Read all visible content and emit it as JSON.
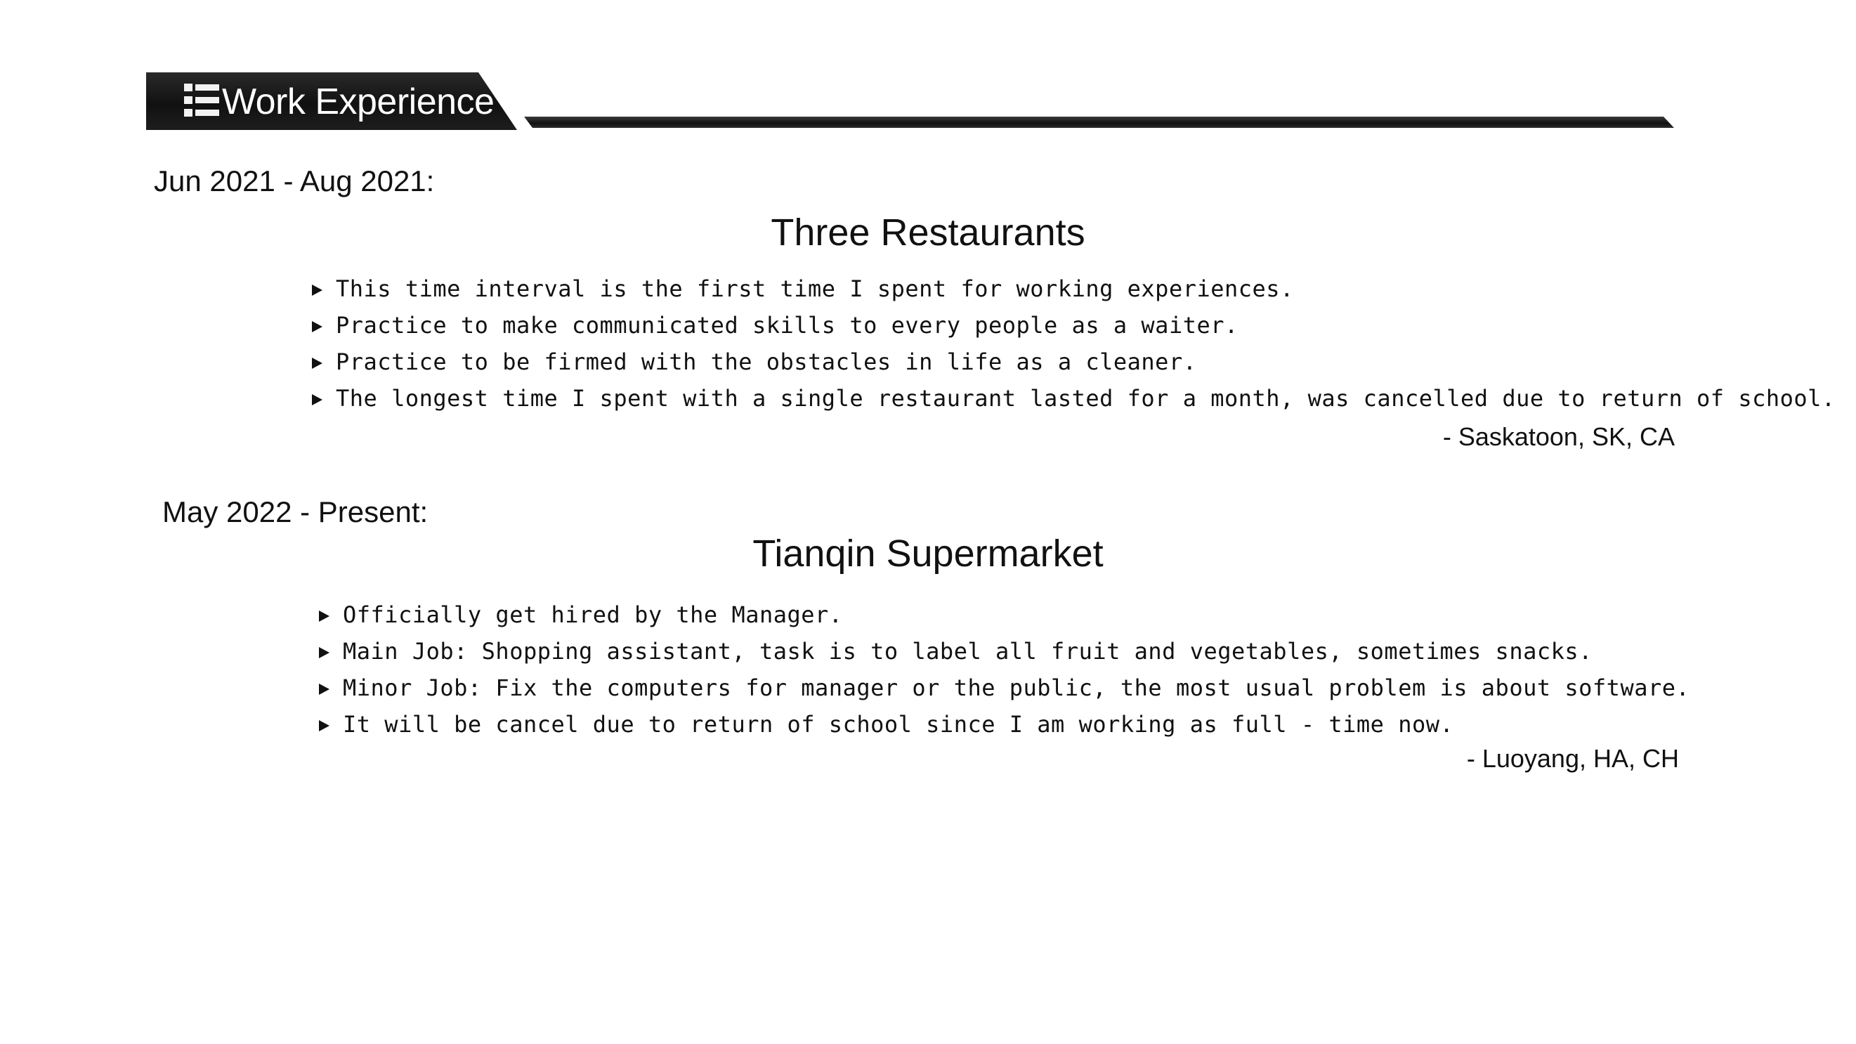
{
  "section": {
    "title": "Work Experience",
    "icon": "list-icon"
  },
  "entries": [
    {
      "date": "Jun 2021 - Aug 2021:",
      "company": "Three Restaurants",
      "bullets": [
        "This time interval is the first time I spent for working experiences.",
        "Practice to make communicated skills to every people as a waiter.",
        "Practice to be firmed with the obstacles in life as a cleaner.",
        "The longest time I spent with a single restaurant lasted for a month, was cancelled due to return of school."
      ],
      "location": "- Saskatoon, SK, CA"
    },
    {
      "date": "May 2022 - Present:",
      "company": "Tianqin Supermarket",
      "bullets": [
        "Officially get hired by the Manager.",
        "Main Job: Shopping assistant, task is to label all fruit and vegetables, sometimes snacks.",
        "Minor Job: Fix the computers for manager or the public, the most usual problem is about software.",
        "It will be cancel due to return of school since I am working as full - time now."
      ],
      "location": "- Luoyang, HA, CH"
    }
  ]
}
